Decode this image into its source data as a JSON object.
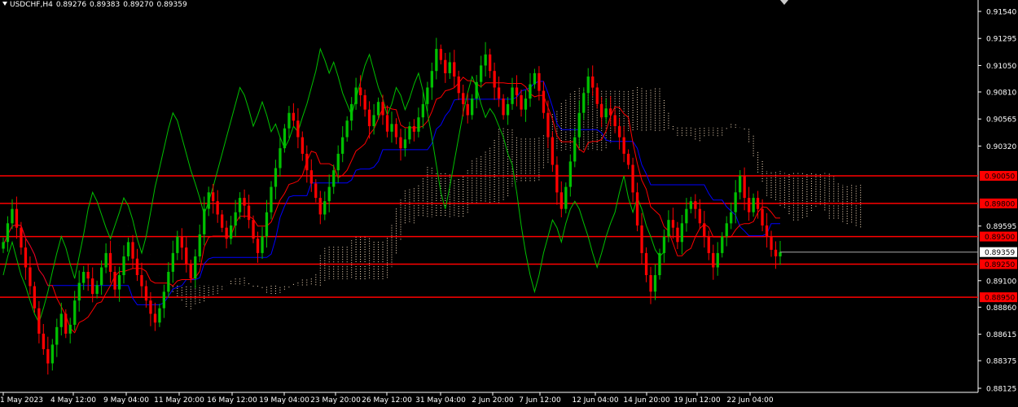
{
  "header": {
    "symbol": "USDCHF,H4",
    "open": "0.89276",
    "high": "0.89383",
    "low": "0.89270",
    "close": "0.89359"
  },
  "colors": {
    "background": "#000000",
    "bull_candle": "#00c000",
    "bear_candle": "#ff0000",
    "level_line": "#ff0000",
    "tenkan": "#ff0000",
    "kijun": "#0000ff",
    "chikou": "#00c000",
    "kumo": "#ffe4c4",
    "axis_text": "#ffffff",
    "current_price_bg": "#ffffff"
  },
  "chart_data": {
    "type": "candlestick",
    "title": "",
    "symbol": "USDCHF",
    "timeframe": "H4",
    "ylim": [
      0.88125,
      0.9154
    ],
    "y_ticks": [
      "0.91540",
      "0.91295",
      "0.91050",
      "0.90810",
      "0.90565",
      "0.90320",
      "0.89595",
      "0.89100",
      "0.88860",
      "0.88615",
      "0.88375",
      "0.88125"
    ],
    "x_ticks": [
      "1 May 2023",
      "4 May 12:00",
      "9 May 04:00",
      "11 May 20:00",
      "16 May 12:00",
      "19 May 04:00",
      "23 May 20:00",
      "26 May 12:00",
      "31 May 04:00",
      "2 Jun 20:00",
      "7 Jun 12:00",
      "12 Jun 04:00",
      "14 Jun 20:00",
      "19 Jun 12:00",
      "22 Jun 04:00"
    ],
    "levels": [
      {
        "label": "0.90050",
        "value": 0.9005
      },
      {
        "label": "0.89800",
        "value": 0.898
      },
      {
        "label": "0.89500",
        "value": 0.895
      },
      {
        "label": "0.89250",
        "value": 0.8925
      },
      {
        "label": "0.88950",
        "value": 0.8895
      }
    ],
    "current_price": {
      "label": "0.89359",
      "value": 0.89359
    },
    "indicator": "Ichimoku Kinko Hyo",
    "closes": [
      0.8945,
      0.8962,
      0.8975,
      0.8958,
      0.894,
      0.8922,
      0.8905,
      0.8885,
      0.8862,
      0.8848,
      0.8835,
      0.8852,
      0.8868,
      0.888,
      0.8862,
      0.887,
      0.8892,
      0.8908,
      0.8918,
      0.8912,
      0.8898,
      0.8906,
      0.8922,
      0.8935,
      0.8918,
      0.8902,
      0.8915,
      0.8932,
      0.8945,
      0.893,
      0.8915,
      0.8905,
      0.8892,
      0.888,
      0.8872,
      0.8885,
      0.89,
      0.8918,
      0.8935,
      0.895,
      0.894,
      0.8925,
      0.8912,
      0.8932,
      0.8952,
      0.8975,
      0.899,
      0.8982,
      0.897,
      0.8958,
      0.8948,
      0.896,
      0.8972,
      0.8985,
      0.8978,
      0.8965,
      0.8948,
      0.8935,
      0.895,
      0.8972,
      0.8995,
      0.9012,
      0.903,
      0.9048,
      0.9062,
      0.9055,
      0.904,
      0.9025,
      0.901,
      0.8998,
      0.8985,
      0.897,
      0.8982,
      0.8995,
      0.901,
      0.9025,
      0.904,
      0.9055,
      0.907,
      0.9085,
      0.9078,
      0.9065,
      0.905,
      0.906,
      0.9072,
      0.906,
      0.9045,
      0.9052,
      0.904,
      0.903,
      0.9038,
      0.905,
      0.9045,
      0.9058,
      0.907,
      0.9085,
      0.91,
      0.912,
      0.911,
      0.9098,
      0.9108,
      0.9095,
      0.908,
      0.907,
      0.906,
      0.9075,
      0.909,
      0.9105,
      0.9115,
      0.91,
      0.9085,
      0.9075,
      0.906,
      0.907,
      0.9085,
      0.9078,
      0.9065,
      0.9075,
      0.9088,
      0.9098,
      0.9082,
      0.9062,
      0.904,
      0.9015,
      0.899,
      0.8975,
      0.8995,
      0.9018,
      0.904,
      0.9062,
      0.908,
      0.9095,
      0.9085,
      0.907,
      0.9058,
      0.9066,
      0.906,
      0.905,
      0.904,
      0.9025,
      0.9015,
      0.899,
      0.896,
      0.8935,
      0.8915,
      0.89,
      0.8915,
      0.8935,
      0.895,
      0.8965,
      0.8958,
      0.8945,
      0.8962,
      0.8975,
      0.8982,
      0.8975,
      0.8962,
      0.895,
      0.8935,
      0.8922,
      0.8935,
      0.895,
      0.8962,
      0.8972,
      0.899,
      0.9005,
      0.8985,
      0.8972,
      0.8985,
      0.8975,
      0.896,
      0.895,
      0.8938,
      0.8932,
      0.8936
    ]
  }
}
